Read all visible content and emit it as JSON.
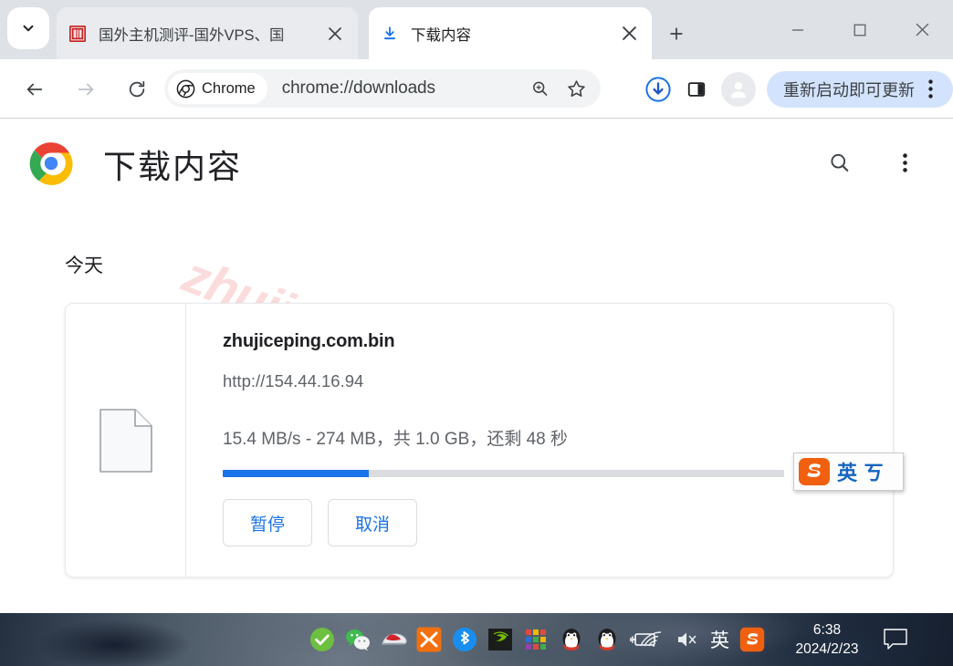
{
  "window": {
    "controls": {
      "minimize": "minimize-icon",
      "maximize": "maximize-icon",
      "close": "close-icon"
    }
  },
  "tabstrip": {
    "tab_search_icon": "chevron-down-icon",
    "new_tab_label": "+",
    "tabs": [
      {
        "title": "国外主机测评-国外VPS、国",
        "favicon": "site-seal-favicon",
        "active": false,
        "close_label": "×"
      },
      {
        "title": "下载内容",
        "favicon": "download-icon",
        "active": true,
        "close_label": "×"
      }
    ]
  },
  "toolbar": {
    "back_icon": "back-arrow-icon",
    "forward_icon": "forward-arrow-icon",
    "reload_icon": "reload-icon",
    "chrome_chip_label": "Chrome",
    "url": "chrome://downloads",
    "zoom_icon": "zoom-search-icon",
    "bookmark_icon": "star-icon",
    "downloads_icon": "downloads-tray-icon",
    "sidepanel_icon": "side-panel-icon",
    "avatar_icon": "profile-avatar-icon",
    "update_button_label": "重新启动即可更新",
    "menu_icon": "three-dot-menu-icon"
  },
  "page": {
    "logo": "chrome-logo",
    "title": "下载内容",
    "search_icon": "search-icon",
    "menu_icon": "three-dot-menu-icon",
    "section_label": "今天",
    "watermark": "zhujiceping.com",
    "download": {
      "file_icon": "generic-file-icon",
      "filename": "zhujiceping.com.bin",
      "url": "http://154.44.16.94",
      "status": "15.4 MB/s - 274 MB，共 1.0 GB，还剩 48 秒",
      "progress_percent": 26,
      "progress_color": "#1a73e8",
      "buttons": [
        {
          "label": "暂停",
          "name": "pause-button"
        },
        {
          "label": "取消",
          "name": "cancel-button"
        }
      ]
    }
  },
  "ime_floating_bar": {
    "logo": "sogou-logo",
    "mode": "英",
    "symbol": "ㄎ"
  },
  "taskbar": {
    "tray_icons": [
      "green-check-icon",
      "wechat-icon",
      "mouse-icon",
      "xampp-icon",
      "bluetooth-icon",
      "nvidia-icon",
      "color-grid-icon",
      "qq-penguin-icon",
      "qq-penguin-icon",
      "battery-charging-icon"
    ],
    "right_icons": [
      "wifi-icon",
      "volume-muted-icon"
    ],
    "ime_lang": "英",
    "sogou_icon": "sogou-icon",
    "time": "6:38",
    "date": "2024/2/23",
    "notifications_icon": "notification-icon"
  },
  "colors": {
    "accent_blue": "#1a73e8",
    "tabstrip_bg": "#dee1e6",
    "update_pill_bg": "#d3e3fd",
    "watermark_pink": "#fbdcdc"
  }
}
